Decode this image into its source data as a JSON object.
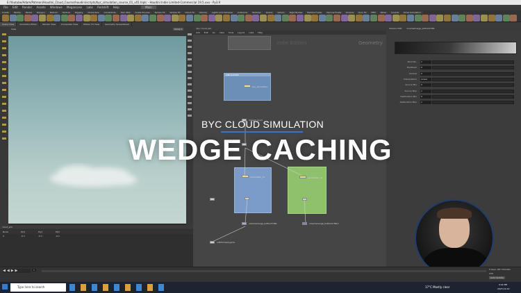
{
  "window": {
    "title": "E:/Youtube/Adam/Patreon/Houdini_Cloud_Course/houdini/scripts/byc_simulation_course_01_v01.hiplc - Houdini Indie Limited-Commercial 19.5.xxx - Py3.9"
  },
  "menu": [
    "File",
    "Edit",
    "Render",
    "Assets",
    "Windows",
    "Megascans",
    "Labs",
    "Redshift",
    "Help",
    "Main"
  ],
  "shelf_tabs": [
    "Create",
    "Modify",
    "Model",
    "Polygon",
    "Deform",
    "Texture",
    "Rigging",
    "Characters",
    "Constraints",
    "Hair Utils",
    "Guide Process",
    "Terrain FX",
    "Simple FX",
    "Cloud FX",
    "Volume",
    "Lights and Cameras",
    "Collisions",
    "Particles",
    "Grains",
    "Vellum",
    "Rigid Bodies",
    "Particle Fluids",
    "Viscous Fluids",
    "Oceans",
    "Pyro FX",
    "FEM",
    "Wires",
    "Crowds",
    "Drive Simulation"
  ],
  "pane_tabs": [
    "Scene View",
    "Animation Editor",
    "Render View",
    "Composite View",
    "Motion FX View",
    "Geometry Spreadsheet"
  ],
  "network": {
    "path": "obj / cloud_sim",
    "menu": [
      "Add",
      "Edit",
      "Go",
      "View",
      "Tools",
      "Layout",
      "Labs",
      "Help"
    ],
    "watermark": "Indie Edition",
    "context": "Geometry",
    "simulation_box": "SIMULATION",
    "nodes": {
      "top": "byc_simulation",
      "import": "import_cloud",
      "cache1": "cachedsim_v1",
      "cache2": "cachedsim_v2",
      "volmerge1": "volumemerge_bottomCTRL",
      "volmerge2": "volumemerge_bottomCTRL1",
      "out": "vdbfrompolygons"
    }
  },
  "overlay": {
    "subtitle": "BYC CLOUD SIMULATION",
    "headline": "WEDGE CACHING"
  },
  "params": {
    "node_name": "volumemerge_bottomCTRL",
    "node_type": "Volume VOP",
    "rows": [
      {
        "label": "Point No.",
        "value": "1"
      },
      {
        "label": "Feedback",
        "value": "0"
      },
      {
        "label": "Vortical",
        "value": "0"
      },
      {
        "label": "Interpolation",
        "value": "Linear"
      },
      {
        "label": "Source Min",
        "value": "0"
      },
      {
        "label": "Source Max",
        "value": "1"
      },
      {
        "label": "Destination Min",
        "value": "0"
      },
      {
        "label": "Destination Max",
        "value": "1"
      }
    ]
  },
  "spreadsheet": {
    "node": "cloud_sim",
    "headers": [
      "Node",
      "P[x]",
      "P[y]",
      "P[z]"
    ],
    "row": [
      "0",
      "-0.1",
      "-0.1",
      "-0.1"
    ]
  },
  "timeline": {
    "frame": "1",
    "end": "240",
    "keys": "0 keys, 0/0 channels",
    "autoupdate": "Auto Update"
  },
  "taskbar": {
    "search": "Type here to search",
    "weather": "17°C  Mostly clear",
    "time": "9:42 PM",
    "date": "2023-10-19"
  },
  "colors": {
    "sim_box": "#6b8fb6",
    "node_box_blue": "#7b9cc8",
    "node_box_green": "#8fc06b",
    "viewport_sky": "#9ab9b8",
    "subtitle_underline": "#3a74c9"
  }
}
